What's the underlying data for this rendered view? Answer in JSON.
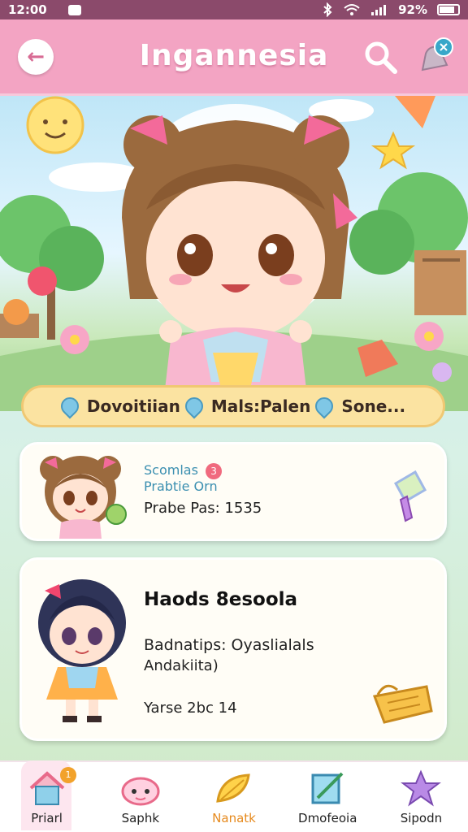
{
  "status_bar": {
    "time": "12:00",
    "battery": "92%"
  },
  "app_bar": {
    "title": "Ingannesia"
  },
  "info_banner": {
    "items": [
      "Dovoitiian",
      "Mals:Palen",
      "Sone..."
    ]
  },
  "card1": {
    "line1": "Scomlas",
    "badge": "3",
    "line2": "Prabtie Orn",
    "line3": "Prabe Pas: 1535"
  },
  "card2": {
    "title": "Haods 8esoola",
    "line1": "Badnatips: Oyaslialals",
    "line2": "Andakiita)",
    "line3": "Yarse 2bc 14"
  },
  "bottom_nav": {
    "badge": "1",
    "items": [
      {
        "label": "Priarl",
        "icon": "house-icon"
      },
      {
        "label": "Saphk",
        "icon": "cloud-face-icon"
      },
      {
        "label": "Nanatk",
        "icon": "leaf-icon"
      },
      {
        "label": "Dmofeoia",
        "icon": "wand-card-icon"
      },
      {
        "label": "Sipodn",
        "icon": "star-gem-icon"
      }
    ],
    "active_index": 2
  },
  "colors": {
    "app_bar": "#f3a4c3",
    "status_bar": "#8b4a6b",
    "banner": "#fbe3a1",
    "active_nav": "#e68a1e"
  }
}
